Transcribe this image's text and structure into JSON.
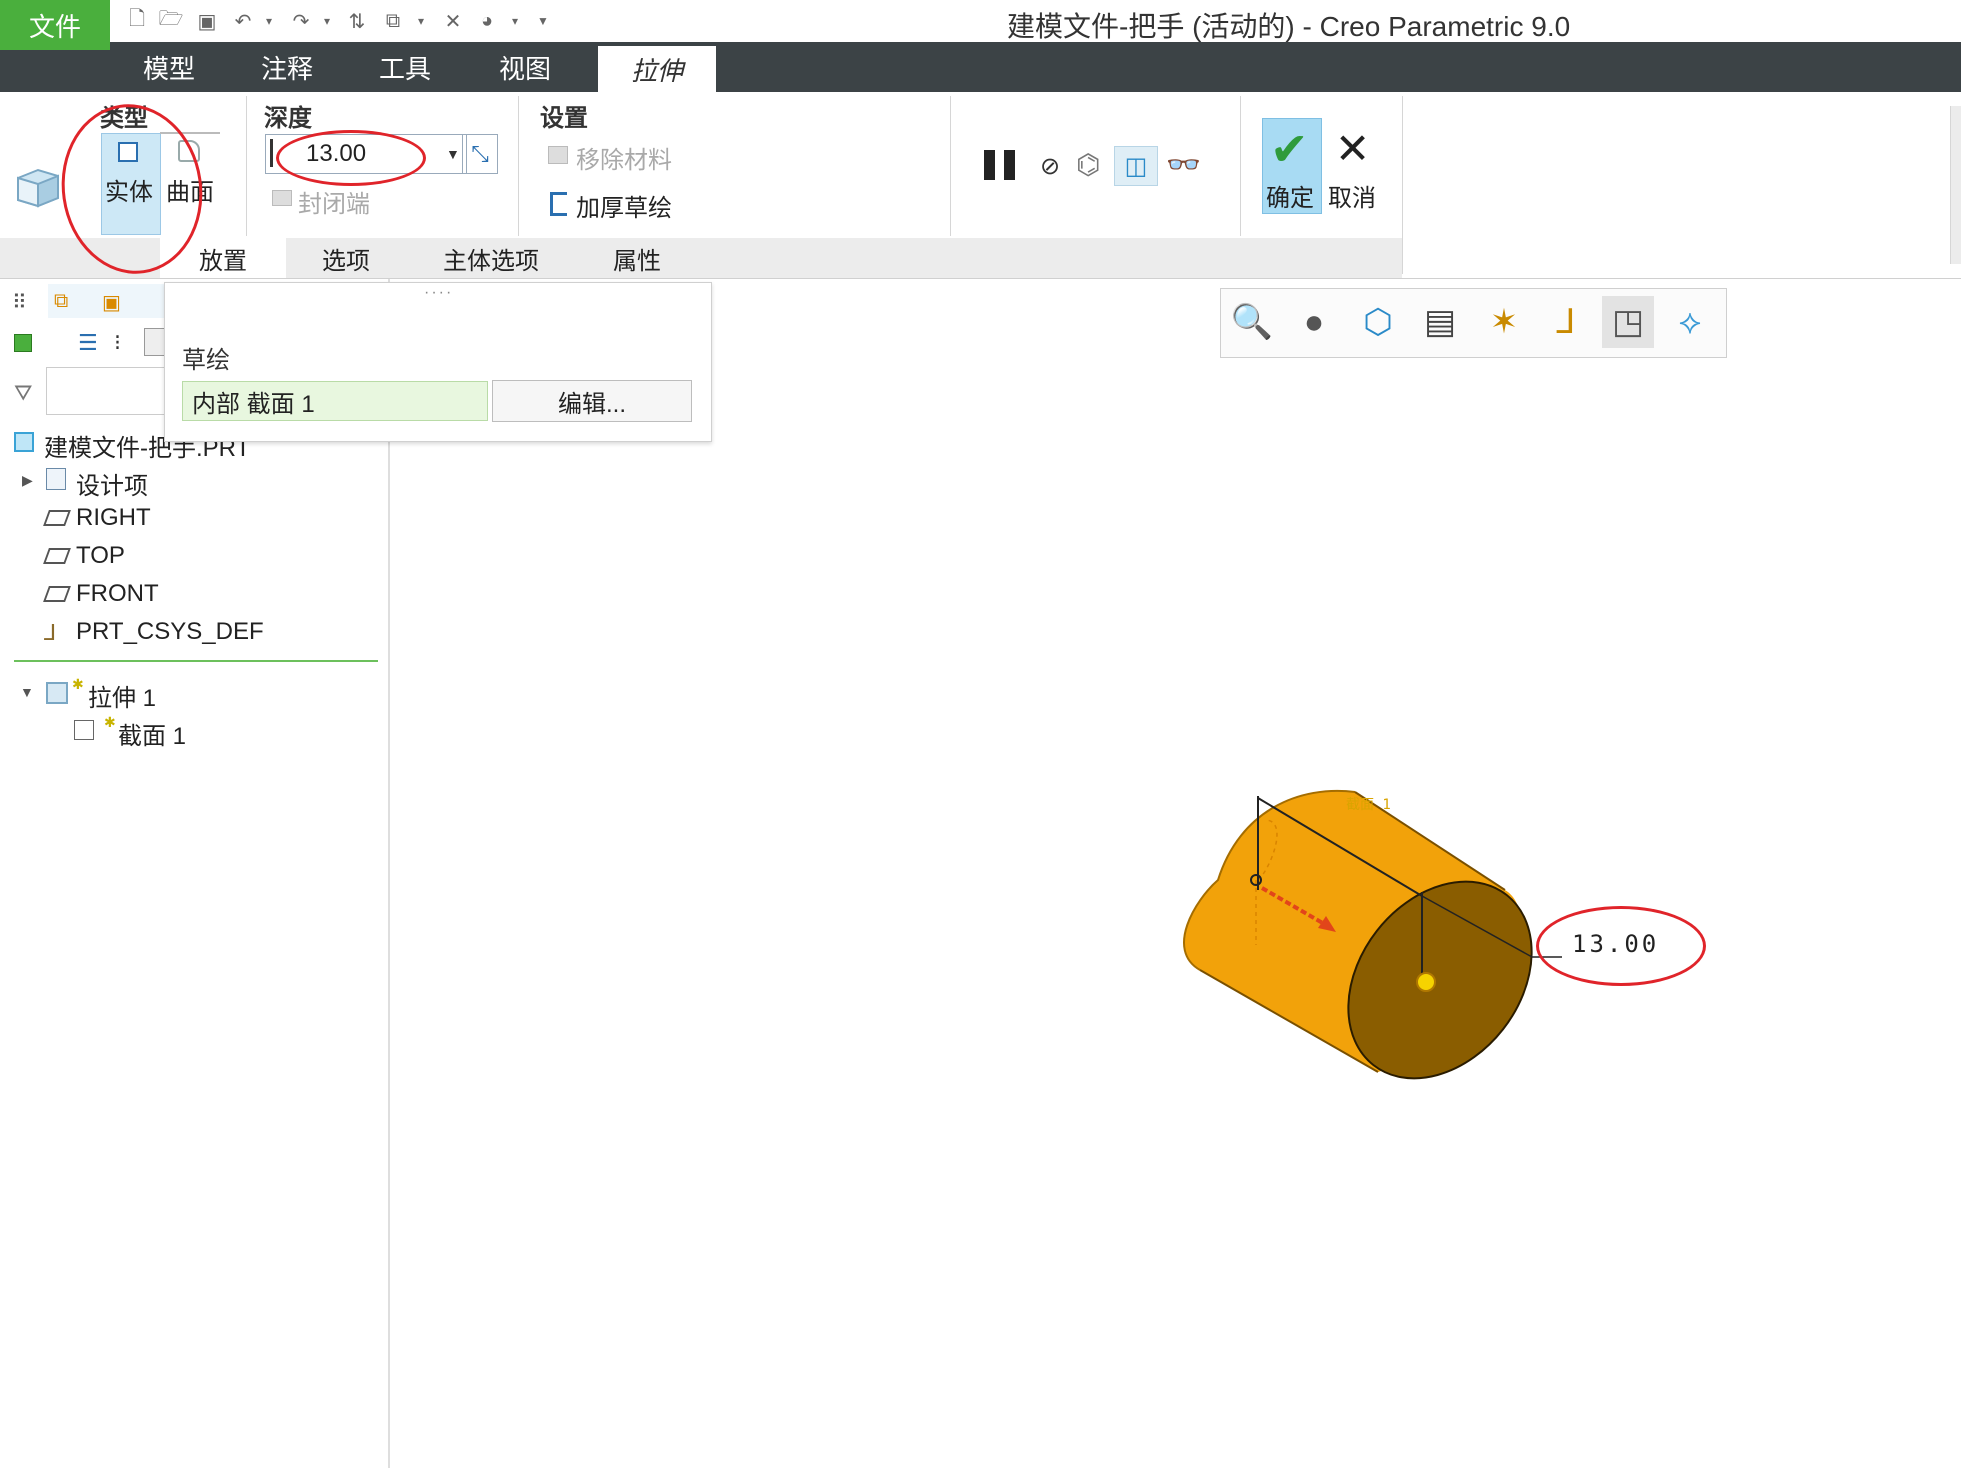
{
  "app": {
    "logo": "creo",
    "title": "建模文件-把手 (活动的) - Creo Parametric 9.0"
  },
  "ribbon_tabs": [
    "文件",
    "模型",
    "注释",
    "工具",
    "视图",
    "拉伸"
  ],
  "ribbon": {
    "type_group": "类型",
    "solid": "实体",
    "surface": "曲面",
    "depth_group": "深度",
    "depth_value": "13.00",
    "capped_ends": "封闭端",
    "settings_group": "设置",
    "remove_material": "移除材料",
    "thicken_sketch": "加厚草绘",
    "ok": "确定",
    "cancel": "取消"
  },
  "subtabs": [
    "放置",
    "选项",
    "主体选项",
    "属性"
  ],
  "placement": {
    "sketch_label": "草绘",
    "section": "内部 截面 1",
    "edit_button": "编辑..."
  },
  "model_tree": {
    "root": "建模文件-把手.PRT",
    "items": [
      "设计项",
      "RIGHT",
      "TOP",
      "FRONT",
      "PRT_CSYS_DEF"
    ],
    "feature": "拉伸 1",
    "feature_child": "截面 1"
  },
  "viewport": {
    "dimension": "13.00",
    "section_tag": "截面 1"
  },
  "colors": {
    "file_tab": "#4aaf3d",
    "tabbar": "#3c4346",
    "model_body": "#f2a20a",
    "model_face": "#8a5d00",
    "annotation": "#e0242a"
  }
}
